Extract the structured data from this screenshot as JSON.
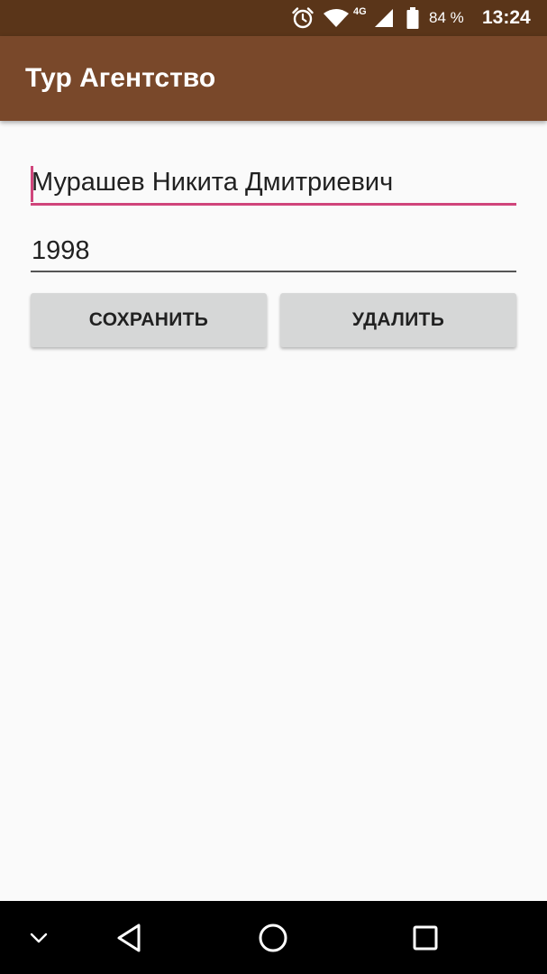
{
  "status_bar": {
    "network_type": "4G",
    "battery_percent": "84 %",
    "time": "13:24",
    "icons": [
      "alarm-icon",
      "wifi-icon",
      "cellular-signal-icon",
      "battery-icon"
    ]
  },
  "app_bar": {
    "title": "Тур Агентство"
  },
  "form": {
    "name_field": {
      "value": "Мурашев Никита Дмитриевич",
      "focused": true
    },
    "year_field": {
      "value": "1998"
    },
    "save_label": "СОХРАНИТЬ",
    "delete_label": "УДАЛИТЬ"
  },
  "nav_bar": {
    "icons": [
      "hide-keyboard-icon",
      "back-icon",
      "home-icon",
      "recents-icon"
    ]
  },
  "colors": {
    "status_bar": "#5a3519",
    "app_bar": "#79482a",
    "accent": "#d0457b",
    "background": "#fafafa",
    "button": "#d6d7d7"
  }
}
